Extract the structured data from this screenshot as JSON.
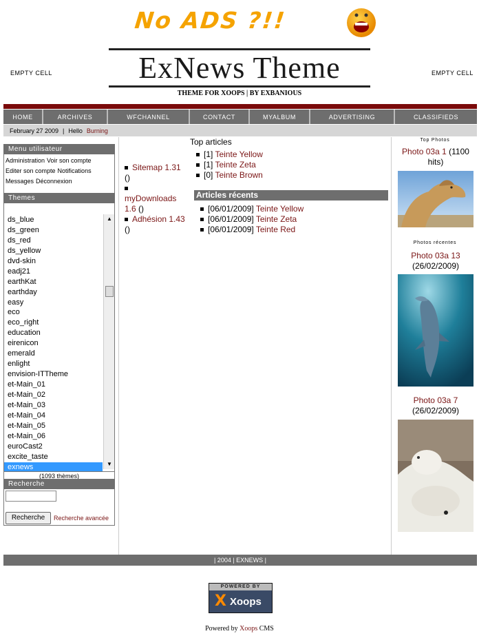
{
  "header": {
    "banner_text": "No ADS ?!!",
    "empty_left": "EMPTY CELL",
    "empty_right": "EMPTY CELL",
    "logo_title": "ExNews Theme",
    "logo_subtitle": "THEME FOR XOOPS | BY EXBANIOUS"
  },
  "nav": [
    "HOME",
    "ARCHIVES",
    "WFCHANNEL",
    "CONTACT",
    "MYALBUM",
    "ADVERTISING",
    "CLASSIFIEDS"
  ],
  "infobar": {
    "date": "February 27 2009",
    "hello": "Hello",
    "user": "Burning"
  },
  "user_menu": {
    "title": "Menu utilisateur",
    "links": [
      "Administration",
      "Voir son compte",
      "Editer son compte",
      "Notifications",
      "Messages",
      "Déconnexion"
    ]
  },
  "themes": {
    "title": "Themes",
    "options": [
      "ds_blue",
      "ds_green",
      "ds_red",
      "ds_yellow",
      "dvd-skin",
      "eadj21",
      "earthKat",
      "earthday",
      "easy",
      "eco",
      "eco_right",
      "education",
      "eirenicon",
      "emerald",
      "enlight",
      "envision-ITTheme",
      "et-Main_01",
      "et-Main_02",
      "et-Main_03",
      "et-Main_04",
      "et-Main_05",
      "et-Main_06",
      "euroCast2",
      "excite_taste",
      "exnews"
    ],
    "selected": "exnews",
    "count": "(1093 thèmes)"
  },
  "search": {
    "title": "Recherche",
    "button": "Recherche",
    "advanced": "Recherche avancée",
    "value": ""
  },
  "center_list": [
    {
      "name": "Sitemap 1.31",
      "extra": "()"
    },
    {
      "name": "",
      "extra": ""
    },
    {
      "name": "myDownloads 1.6",
      "extra": "()"
    },
    {
      "name": "Adhésion 1.43",
      "extra": "()"
    }
  ],
  "top_articles": {
    "title": "Top articles",
    "items": [
      {
        "count": "[1]",
        "title": "Teinte Yellow"
      },
      {
        "count": "[1]",
        "title": "Teinte Zeta"
      },
      {
        "count": "[0]",
        "title": "Teinte Brown"
      }
    ]
  },
  "recent_articles": {
    "title": "Articles récents",
    "items": [
      {
        "date": "[06/01/2009]",
        "title": "Teinte Yellow"
      },
      {
        "date": "[06/01/2009]",
        "title": "Teinte Zeta"
      },
      {
        "date": "[06/01/2009]",
        "title": "Teinte Red"
      }
    ]
  },
  "right": {
    "top_photos_caption": "Top Photos",
    "top_photo": {
      "title": "Photo 03a 1",
      "meta": "(1100 hits)"
    },
    "recent_caption": "Photos récentes",
    "recent_1": {
      "title": "Photo 03a 13",
      "meta": "(26/02/2009)"
    },
    "recent_2": {
      "title": "Photo 03a 7",
      "meta": "(26/02/2009)"
    }
  },
  "footer": {
    "bar_text": "| 2004 | EXNEWS |",
    "badge_top": "POWERED BY",
    "badge_name": "Xoops",
    "powered_prefix": "Powered by",
    "powered_link": "Xoops",
    "powered_suffix": "CMS"
  },
  "colors": {
    "nav_bg": "#6e6e6e",
    "accent_red": "#7a0a0a",
    "link": "#7a1515",
    "select": "#3399ff"
  }
}
